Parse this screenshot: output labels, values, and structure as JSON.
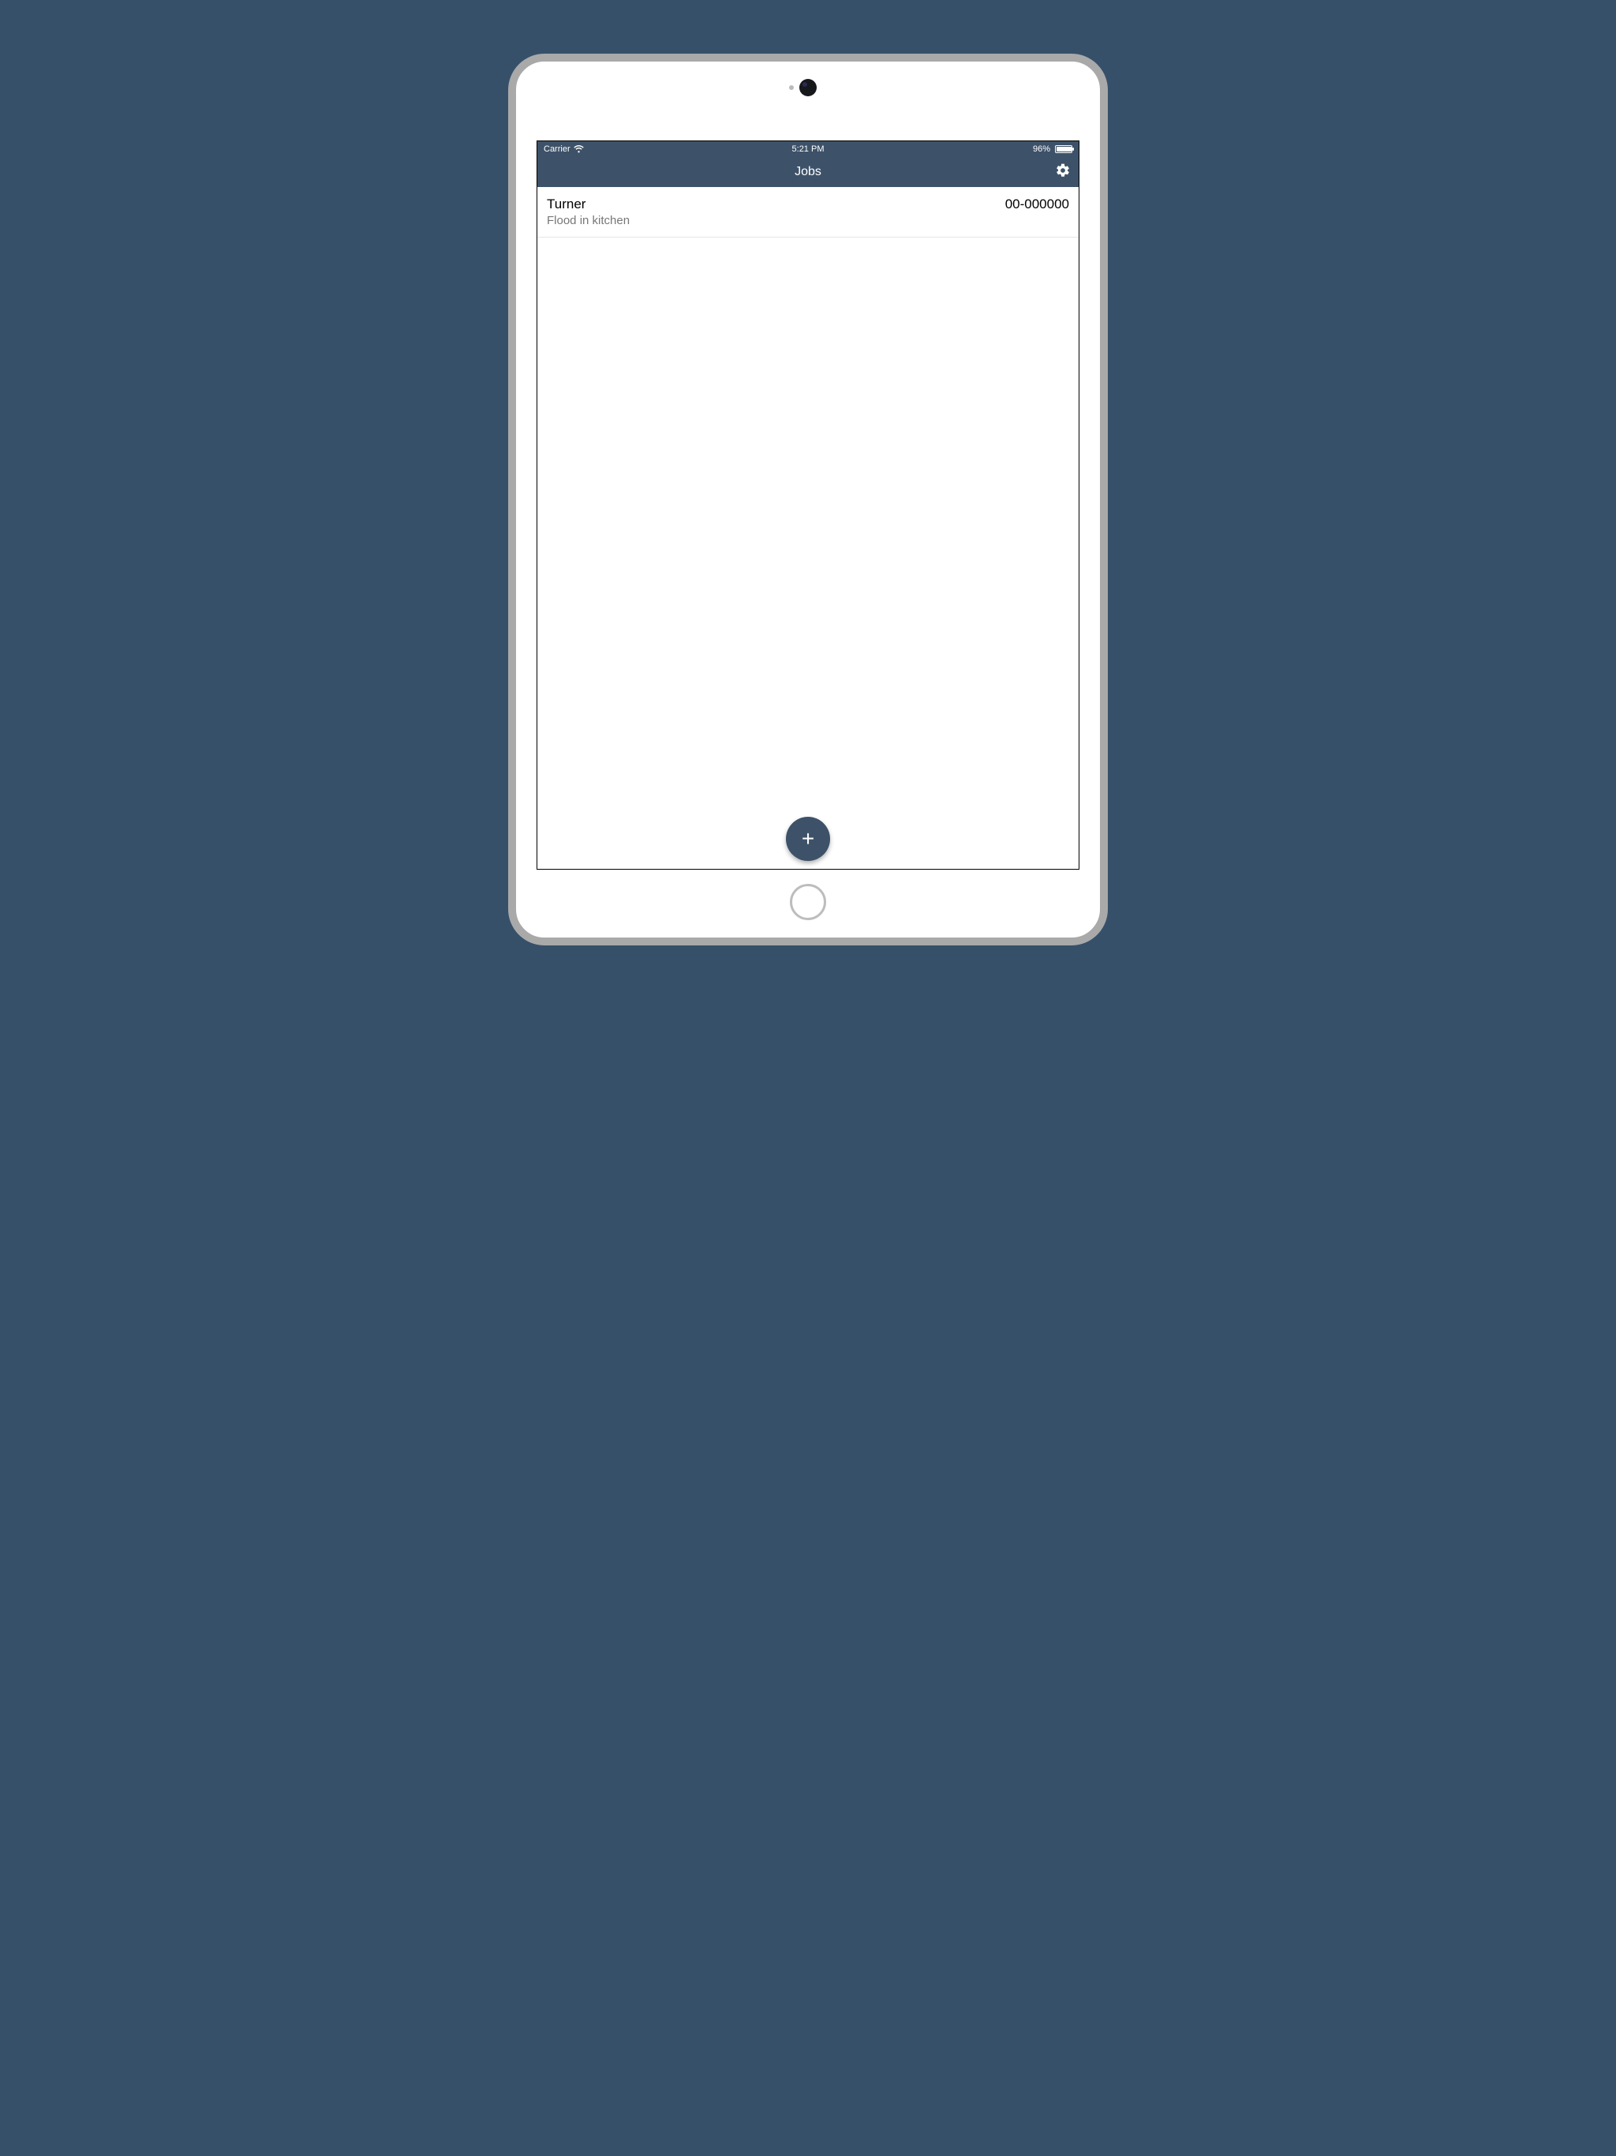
{
  "status_bar": {
    "carrier": "Carrier",
    "time": "5:21 PM",
    "battery_percent": "96%"
  },
  "nav": {
    "title": "Jobs",
    "settings_icon": "gear-icon"
  },
  "jobs": [
    {
      "name": "Turner",
      "description": "Flood in kitchen",
      "id": "00-000000"
    }
  ],
  "fab": {
    "label": "+"
  },
  "colors": {
    "header": "#3D5269",
    "background": "#36506A",
    "subtext": "#777777"
  }
}
